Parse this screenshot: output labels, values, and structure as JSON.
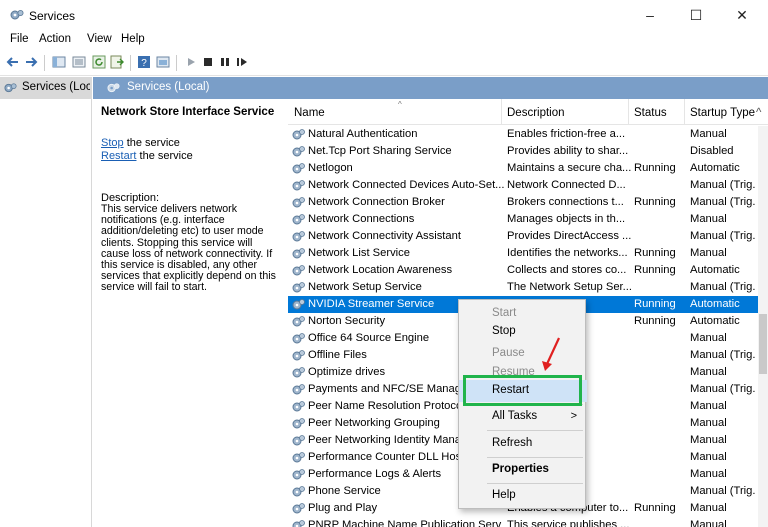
{
  "window": {
    "title": "Services",
    "minimize": "–",
    "maximize": "☐",
    "close": "✕"
  },
  "menu": [
    "File",
    "Action",
    "View",
    "Help"
  ],
  "tree": {
    "root": "Services (Loca"
  },
  "main_header": "Services (Local)",
  "detail": {
    "service_name": "Network Store Interface Service",
    "stop_link": "Stop",
    "stop_suffix": " the service",
    "restart_link": "Restart",
    "restart_suffix": " the service",
    "description_label": "Description:",
    "description": "This service delivers network notifications (e.g. interface addition/deleting etc) to user mode clients. Stopping this service will cause loss of network connectivity. If this service is disabled, any other services that explicitly depend on this service will fail to start."
  },
  "columns": {
    "name": "Name",
    "description": "Description",
    "status": "Status",
    "startup": "Startup Type"
  },
  "rows": [
    {
      "name": "Natural Authentication",
      "description": "Enables friction-free a...",
      "status": "",
      "startup": "Manual"
    },
    {
      "name": "Net.Tcp Port Sharing Service",
      "description": "Provides ability to shar...",
      "status": "",
      "startup": "Disabled"
    },
    {
      "name": "Netlogon",
      "description": "Maintains a secure cha...",
      "status": "Running",
      "startup": "Automatic"
    },
    {
      "name": "Network Connected Devices Auto-Set...",
      "description": "Network Connected D...",
      "status": "",
      "startup": "Manual (Trig."
    },
    {
      "name": "Network Connection Broker",
      "description": "Brokers connections t...",
      "status": "Running",
      "startup": "Manual (Trig."
    },
    {
      "name": "Network Connections",
      "description": "Manages objects in th...",
      "status": "",
      "startup": "Manual"
    },
    {
      "name": "Network Connectivity Assistant",
      "description": "Provides DirectAccess ...",
      "status": "",
      "startup": "Manual (Trig."
    },
    {
      "name": "Network List Service",
      "description": "Identifies the networks...",
      "status": "Running",
      "startup": "Manual"
    },
    {
      "name": "Network Location Awareness",
      "description": "Collects and stores co...",
      "status": "Running",
      "startup": "Automatic"
    },
    {
      "name": "Network Setup Service",
      "description": "The Network Setup Ser...",
      "status": "",
      "startup": "Manual (Trig."
    },
    {
      "name": "NVIDIA Streamer Service",
      "description": "rs ne...",
      "status": "Running",
      "startup": "Automatic",
      "selected": true
    },
    {
      "name": "Norton Security",
      "description": "",
      "status": "Running",
      "startup": "Automatic"
    },
    {
      "name": "Office 64 Source Engine",
      "description": "iles ...",
      "status": "",
      "startup": "Manual"
    },
    {
      "name": "Offline Files",
      "description": "ervic...",
      "status": "",
      "startup": "Manual (Trig."
    },
    {
      "name": "Optimize drives",
      "description": "er ru...",
      "status": "",
      "startup": "Manual"
    },
    {
      "name": "Payments and NFC/SE Manager",
      "description": "s an...",
      "status": "",
      "startup": "Manual (Trig."
    },
    {
      "name": "Peer Name Resolution Protocol",
      "description": "peer...",
      "status": "",
      "startup": "Manual"
    },
    {
      "name": "Peer Networking Grouping",
      "description": "y co...",
      "status": "",
      "startup": "Manual"
    },
    {
      "name": "Peer Networking Identity Manag",
      "description": "ervi...",
      "status": "",
      "startup": "Manual"
    },
    {
      "name": "Performance Counter DLL Host",
      "description": "ers a...",
      "status": "",
      "startup": "Manual"
    },
    {
      "name": "Performance Logs & Alerts",
      "description": "and...",
      "status": "",
      "startup": "Manual"
    },
    {
      "name": "Phone Service",
      "description": "hon...",
      "status": "",
      "startup": "Manual (Trig."
    },
    {
      "name": "Plug and Play",
      "description": "Enables a computer to...",
      "status": "Running",
      "startup": "Manual"
    },
    {
      "name": "PNRP Machine Name Publication Serv",
      "description": "This service publishes ...",
      "status": "",
      "startup": "Manual"
    }
  ],
  "context_menu": {
    "start": "Start",
    "stop": "Stop",
    "pause": "Pause",
    "resume": "Resume",
    "restart": "Restart",
    "all_tasks": "All Tasks",
    "all_tasks_arrow": ">",
    "refresh": "Refresh",
    "properties": "Properties",
    "help": "Help"
  },
  "colors": {
    "selection": "#0078d7",
    "header_blue": "#7a9ec8",
    "highlight_green": "#20b44b",
    "arrow_red": "#e02020"
  },
  "icons": {
    "app": "services-gear-icon",
    "row": "service-gear-icon"
  }
}
